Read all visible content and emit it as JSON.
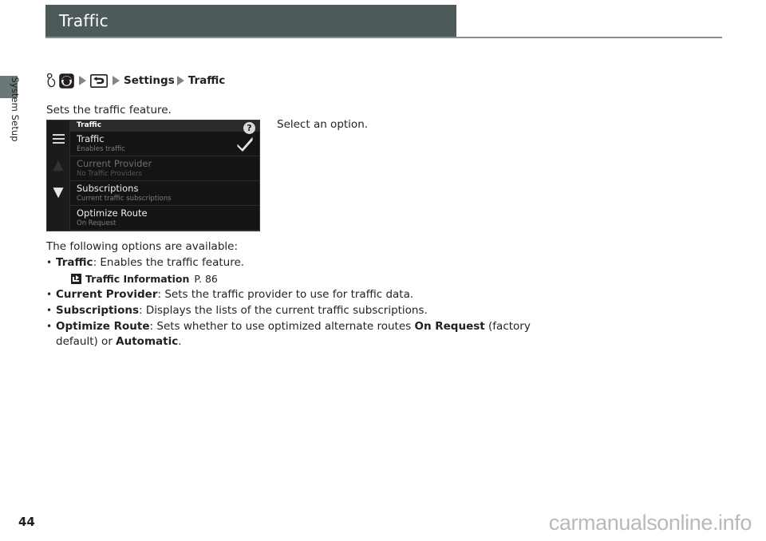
{
  "header": {
    "title": "Traffic",
    "bar_color": "#4c5a5a"
  },
  "side_tab": {
    "label": "System Setup",
    "color": "#6a7878"
  },
  "breadcrumb": {
    "icons": [
      "hand-press-icon",
      "map-button-icon",
      "back-button-icon"
    ],
    "items": [
      {
        "label": "Settings"
      },
      {
        "label": "Traffic"
      }
    ]
  },
  "intro": {
    "line": "Sets the traffic feature."
  },
  "callout": {
    "text": "Select an option."
  },
  "navscreen": {
    "title": "Traffic",
    "help_icon": "?",
    "rail": {
      "menu_icon": "hamburger-icon",
      "up_icon": "▲",
      "down_icon": "▼"
    },
    "rows": [
      {
        "title": "Traffic",
        "subtitle": "Enables traffic",
        "checked": true,
        "dim": false
      },
      {
        "title": "Current Provider",
        "subtitle": "No Traffic Providers",
        "checked": false,
        "dim": true
      },
      {
        "title": "Subscriptions",
        "subtitle": "Current traffic subscriptions",
        "checked": false,
        "dim": false
      },
      {
        "title": "Optimize Route",
        "subtitle": "On Request",
        "checked": false,
        "dim": false
      }
    ]
  },
  "options": {
    "lead": "The following options are available:",
    "bullet": "•",
    "items": [
      {
        "name": "Traffic",
        "desc": ": Enables the traffic feature.",
        "reference": {
          "title": "Traffic Information",
          "page": "P. 86"
        }
      },
      {
        "name": "Current Provider",
        "desc": ": Sets the traffic provider to use for traffic data."
      },
      {
        "name": "Subscriptions",
        "desc": ": Displays the lists of the current traffic subscriptions."
      },
      {
        "name": "Optimize Route",
        "desc_pre": ": Sets whether to use optimized alternate routes ",
        "value1": "On Request",
        "desc_mid": " (factory default) or ",
        "value2": "Automatic",
        "desc_post": "."
      }
    ]
  },
  "footer": {
    "page_number": "44",
    "watermark": "carmanualsonline.info"
  }
}
